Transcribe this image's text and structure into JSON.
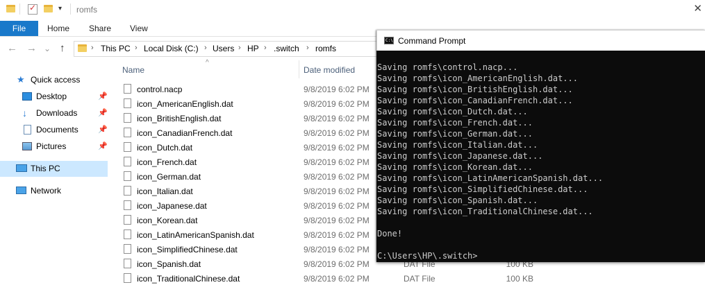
{
  "titlebar": {
    "title": "romfs",
    "dropdown_glyph": "▾",
    "close_glyph": "✕",
    "check_glyph": "✓"
  },
  "ribbon": {
    "tabs": [
      "File",
      "Home",
      "Share",
      "View"
    ]
  },
  "nav": {
    "back": "←",
    "forward": "→",
    "recent": "⌄",
    "up": "↑",
    "breadcrumb": [
      "This PC",
      "Local Disk (C:)",
      "Users",
      "HP",
      ".switch",
      "romfs"
    ],
    "separator": "›"
  },
  "navpane": {
    "quick_access": "Quick access",
    "items": [
      {
        "label": "Desktop",
        "icon": "desktop-icon",
        "pinned": true
      },
      {
        "label": "Downloads",
        "icon": "downloads-icon",
        "pinned": true
      },
      {
        "label": "Documents",
        "icon": "documents-icon",
        "pinned": true
      },
      {
        "label": "Pictures",
        "icon": "pictures-icon",
        "pinned": true
      }
    ],
    "this_pc": "This PC",
    "network": "Network",
    "pin_glyph": "📌",
    "star_glyph": "★"
  },
  "list": {
    "columns": {
      "name": "Name",
      "date": "Date modified"
    },
    "sort_glyph": "^",
    "files": [
      {
        "name": "control.nacp",
        "date": "9/8/2019 6:02 PM",
        "type": "",
        "size": ""
      },
      {
        "name": "icon_AmericanEnglish.dat",
        "date": "9/8/2019 6:02 PM",
        "type": "",
        "size": ""
      },
      {
        "name": "icon_BritishEnglish.dat",
        "date": "9/8/2019 6:02 PM",
        "type": "",
        "size": ""
      },
      {
        "name": "icon_CanadianFrench.dat",
        "date": "9/8/2019 6:02 PM",
        "type": "",
        "size": ""
      },
      {
        "name": "icon_Dutch.dat",
        "date": "9/8/2019 6:02 PM",
        "type": "",
        "size": ""
      },
      {
        "name": "icon_French.dat",
        "date": "9/8/2019 6:02 PM",
        "type": "",
        "size": ""
      },
      {
        "name": "icon_German.dat",
        "date": "9/8/2019 6:02 PM",
        "type": "",
        "size": ""
      },
      {
        "name": "icon_Italian.dat",
        "date": "9/8/2019 6:02 PM",
        "type": "",
        "size": ""
      },
      {
        "name": "icon_Japanese.dat",
        "date": "9/8/2019 6:02 PM",
        "type": "",
        "size": ""
      },
      {
        "name": "icon_Korean.dat",
        "date": "9/8/2019 6:02 PM",
        "type": "",
        "size": ""
      },
      {
        "name": "icon_LatinAmericanSpanish.dat",
        "date": "9/8/2019 6:02 PM",
        "type": "",
        "size": ""
      },
      {
        "name": "icon_SimplifiedChinese.dat",
        "date": "9/8/2019 6:02 PM",
        "type": "",
        "size": ""
      },
      {
        "name": "icon_Spanish.dat",
        "date": "9/8/2019 6:02 PM",
        "type": "DAT File",
        "size": "100 KB"
      },
      {
        "name": "icon_TraditionalChinese.dat",
        "date": "9/8/2019 6:02 PM",
        "type": "DAT File",
        "size": "100 KB"
      }
    ]
  },
  "cmd": {
    "title": "Command Prompt",
    "icon_text": "C:\\",
    "lines": [
      "Saving romfs\\control.nacp...",
      "Saving romfs\\icon_AmericanEnglish.dat...",
      "Saving romfs\\icon_BritishEnglish.dat...",
      "Saving romfs\\icon_CanadianFrench.dat...",
      "Saving romfs\\icon_Dutch.dat...",
      "Saving romfs\\icon_French.dat...",
      "Saving romfs\\icon_German.dat...",
      "Saving romfs\\icon_Italian.dat...",
      "Saving romfs\\icon_Japanese.dat...",
      "Saving romfs\\icon_Korean.dat...",
      "Saving romfs\\icon_LatinAmericanSpanish.dat...",
      "Saving romfs\\icon_SimplifiedChinese.dat...",
      "Saving romfs\\icon_Spanish.dat...",
      "Saving romfs\\icon_TraditionalChinese.dat...",
      "",
      "Done!",
      "",
      "C:\\Users\\HP\\.switch>"
    ]
  },
  "colors": {
    "accent": "#1979ca",
    "selection": "#cce8ff",
    "console_bg": "#0c0c0c",
    "console_fg": "#cccccc"
  }
}
